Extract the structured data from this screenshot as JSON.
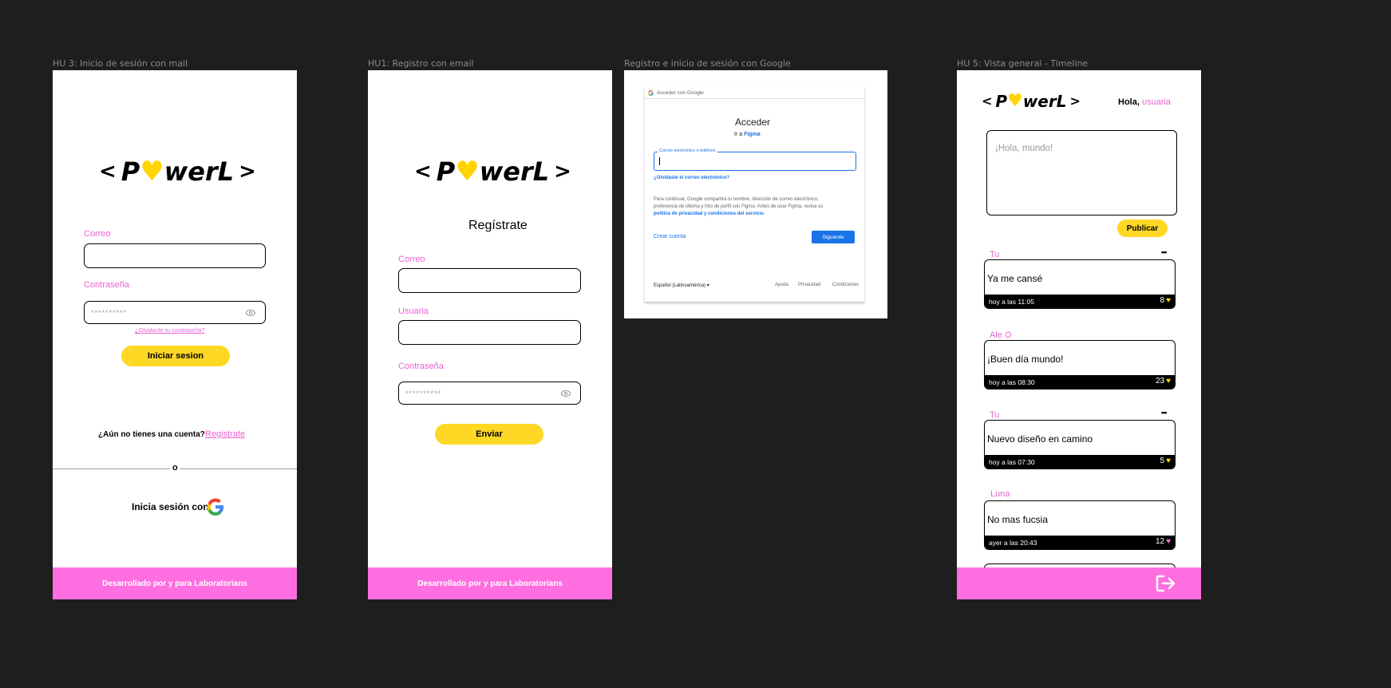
{
  "frames": {
    "login": {
      "title": "HU 3: Inicio de sesión con mail",
      "logo": {
        "left": "<",
        "p": "P",
        "heart": "♥",
        "rest": "werL",
        "right": ">"
      },
      "email_label": "Correo",
      "password_label": "Contraseña",
      "password_dots": "**********",
      "forgot_link": "¿Olvidaste tu contraseña?",
      "submit": "Iniciar sesion",
      "no_account": "¿Aún no tienes una cuenta?",
      "register_link": "Registrate",
      "or": "o",
      "google_text": "Inicia sesión con",
      "footer": "Desarrollado por y para Laboratorians"
    },
    "register": {
      "title": "HU1: Registro con email",
      "logo": {
        "left": "<",
        "p": "P",
        "heart": "♥",
        "rest": "werL",
        "right": ">"
      },
      "heading": "Regístrate",
      "email_label": "Correo",
      "user_label": "Usuaria",
      "password_label": "Contraseña",
      "password_dots": "**********",
      "submit": "Enviar",
      "footer": "Desarrollado por y para Laboratorians"
    },
    "google": {
      "title": "Registro e inicio de sesión con Google",
      "header": "Acceder con Google",
      "heading": "Acceder",
      "subheading_prefix": "Ir a",
      "subheading_app": "Figma",
      "input_label": "Correo electrónico o teléfono",
      "forgot": "¿Olvidaste el correo electrónico?",
      "info_line1": "Para continuar, Google compartirá tu nombre, dirección de correo electrónico,",
      "info_line2": "preferencia de idioma y foto de perfil con Figma. Antes de usar Figma, revisa su",
      "info_link": "política de privacidad y condiciones del servicio.",
      "create": "Crear cuenta",
      "next": "Siguiente",
      "language": "Español (Latinoamérica)",
      "help": "Ayuda",
      "privacy": "Privacidad",
      "terms": "Condiciones"
    },
    "timeline": {
      "title": "HU 5: Vista general - Timeline",
      "logo": {
        "left": "<",
        "p": "P",
        "heart": "♥",
        "rest": "werL",
        "right": ">"
      },
      "greeting": "Hola,",
      "username": "usuaria",
      "compose_placeholder": "¡Hola, mundo!",
      "publish": "Publicar",
      "more_icon": "•••",
      "posts": [
        {
          "author": "Tu",
          "text": "Ya me cansé",
          "time": "hoy a las 11:05",
          "likes": "8",
          "heart_color": "#ffd400"
        },
        {
          "author": "Ale O",
          "text": "¡Buen día mundo!",
          "time": "hoy a las 08:30",
          "likes": "23",
          "heart_color": "#ffd400"
        },
        {
          "author": "Tu",
          "text": "Nuevo diseño en camino",
          "time": "hoy a las 07:30",
          "likes": "5",
          "heart_color": "#ffd400"
        },
        {
          "author": "Luna",
          "text": "No mas fucsia",
          "time": "ayer a las 20:43",
          "likes": "12",
          "heart_color": "#ff6ee0"
        }
      ]
    }
  },
  "colors": {
    "pink": "#ff6ee0",
    "yellow": "#ffd825",
    "canvas": "#1e1e1e",
    "google_blue": "#1a73e8"
  }
}
